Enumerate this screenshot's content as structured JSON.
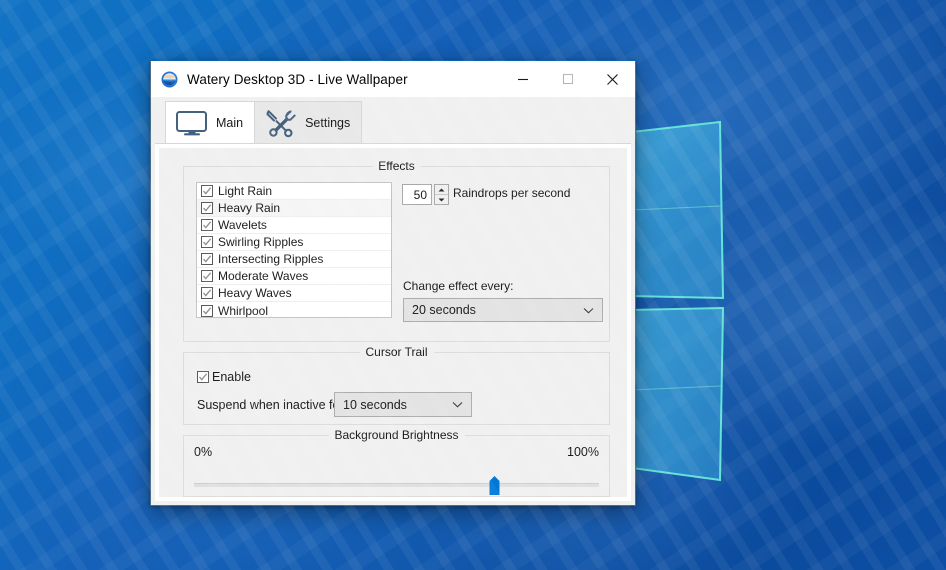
{
  "desktop": {
    "logo_name": "windows-logo"
  },
  "window": {
    "title": "Watery Desktop 3D - Live Wallpaper",
    "icon": "app-globe-icon",
    "controls": {
      "minimize": "minimize-icon",
      "maximize": "maximize-icon",
      "close": "close-icon"
    }
  },
  "tabs": [
    {
      "label": "Main",
      "icon": "monitor-icon",
      "active": true
    },
    {
      "label": "Settings",
      "icon": "tools-icon",
      "active": false
    }
  ],
  "effects": {
    "group_title": "Effects",
    "items": [
      {
        "label": "Light Rain",
        "checked": true
      },
      {
        "label": "Heavy Rain",
        "checked": true
      },
      {
        "label": "Wavelets",
        "checked": true
      },
      {
        "label": "Swirling Ripples",
        "checked": true
      },
      {
        "label": "Intersecting Ripples",
        "checked": true
      },
      {
        "label": "Moderate Waves",
        "checked": true
      },
      {
        "label": "Heavy Waves",
        "checked": true
      },
      {
        "label": "Whirlpool",
        "checked": true
      }
    ],
    "raindrops": {
      "value": "50",
      "caption": "Raindrops per second"
    },
    "change_effect": {
      "label": "Change effect every:",
      "value": "20 seconds"
    }
  },
  "cursor_trail": {
    "group_title": "Cursor Trail",
    "enable_label": "Enable",
    "enable_checked": true,
    "suspend_label": "Suspend when inactive for",
    "suspend_value": "10 seconds"
  },
  "brightness": {
    "group_title": "Background Brightness",
    "min_label": "0%",
    "max_label": "100%",
    "value_percent": 74,
    "thumb_color": "#0078d7"
  }
}
